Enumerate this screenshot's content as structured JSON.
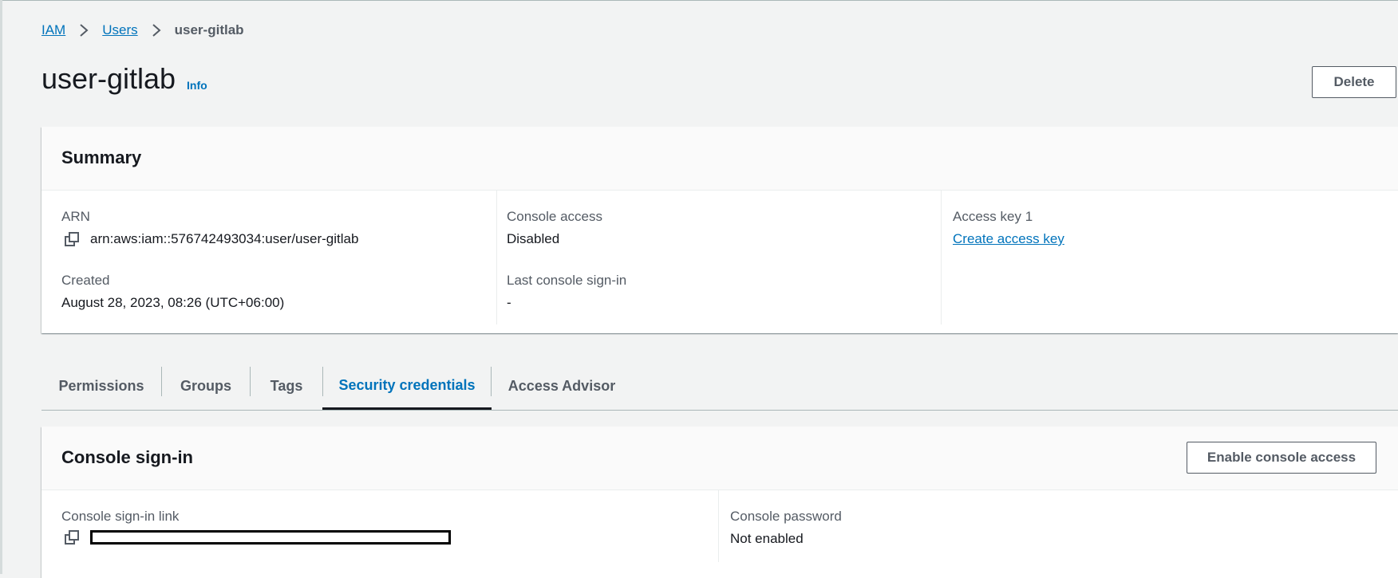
{
  "breadcrumb": {
    "items": [
      "IAM",
      "Users"
    ],
    "current": "user-gitlab",
    "separator": "›"
  },
  "header": {
    "title": "user-gitlab",
    "info_label": "Info",
    "delete_label": "Delete"
  },
  "summary": {
    "title": "Summary",
    "arn_label": "ARN",
    "arn_value": "arn:aws:iam::576742493034:user/user-gitlab",
    "created_label": "Created",
    "created_value": "August 28, 2023, 08:26 (UTC+06:00)",
    "console_access_label": "Console access",
    "console_access_value": "Disabled",
    "last_signin_label": "Last console sign-in",
    "last_signin_value": "-",
    "access_key_label": "Access key 1",
    "access_key_link": "Create access key"
  },
  "tabs": [
    {
      "label": "Permissions"
    },
    {
      "label": "Groups"
    },
    {
      "label": "Tags"
    },
    {
      "label": "Security credentials",
      "active": true
    },
    {
      "label": "Access Advisor"
    }
  ],
  "console_signin": {
    "title": "Console sign-in",
    "enable_label": "Enable console access",
    "link_label": "Console sign-in link",
    "password_label": "Console password",
    "password_value": "Not enabled"
  },
  "colors": {
    "link": "#0073bb",
    "background": "#f2f3f3",
    "text": "#16191f",
    "secondary_text": "#545b64"
  },
  "icons": [
    "chevron-right-icon",
    "copy-icon"
  ]
}
